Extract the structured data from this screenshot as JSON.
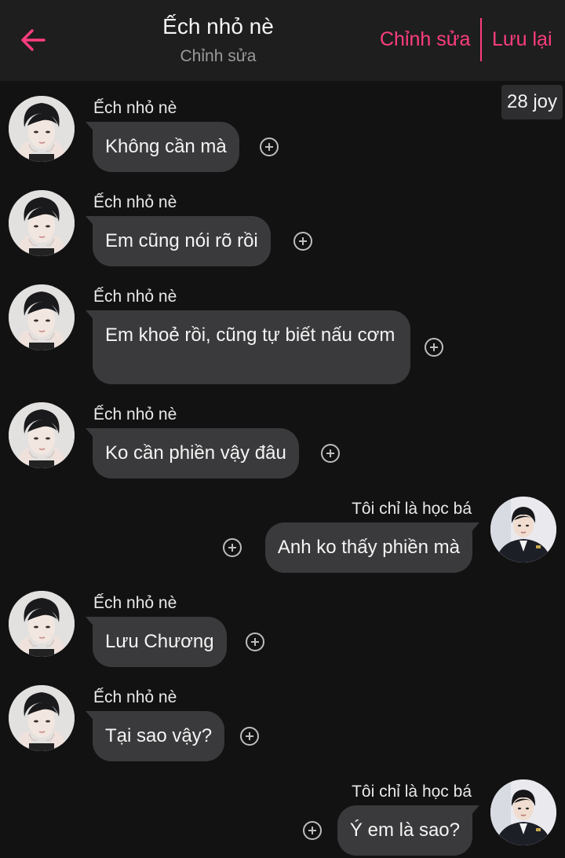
{
  "header": {
    "title": "Ếch nhỏ nè",
    "subtitle": "Chỉnh sửa",
    "edit_label": "Chỉnh sửa",
    "save_label": "Lưu lại"
  },
  "count_badge": "28 joy",
  "messages": [
    {
      "sender": "Ếch nhỏ nè",
      "text": "Không cần mà",
      "direction": "incoming"
    },
    {
      "sender": "Ếch nhỏ nè",
      "text": "Em cũng nói rõ rồi",
      "direction": "incoming"
    },
    {
      "sender": "Ếch nhỏ nè",
      "text": "Em khoẻ rồi, cũng tự biết nấu cơm",
      "direction": "incoming"
    },
    {
      "sender": "Ếch nhỏ nè",
      "text": "Ko cần phiền vậy đâu",
      "direction": "incoming"
    },
    {
      "sender": "Tôi chỉ là học bá",
      "text": "Anh ko thấy phiền mà",
      "direction": "outgoing"
    },
    {
      "sender": "Ếch nhỏ nè",
      "text": "Lưu Chương",
      "direction": "incoming"
    },
    {
      "sender": "Ếch nhỏ nè",
      "text": "Tại sao vậy?",
      "direction": "incoming"
    },
    {
      "sender": "Tôi chỉ là học bá",
      "text": "Ý em là sao?",
      "direction": "outgoing"
    }
  ],
  "colors": {
    "accent": "#ff3d7f",
    "background": "#121213",
    "header_bg": "#1e1e1f",
    "bubble": "#3a3a3c"
  },
  "icons": {
    "back": "arrow-left-icon",
    "add": "plus-circle-icon"
  }
}
